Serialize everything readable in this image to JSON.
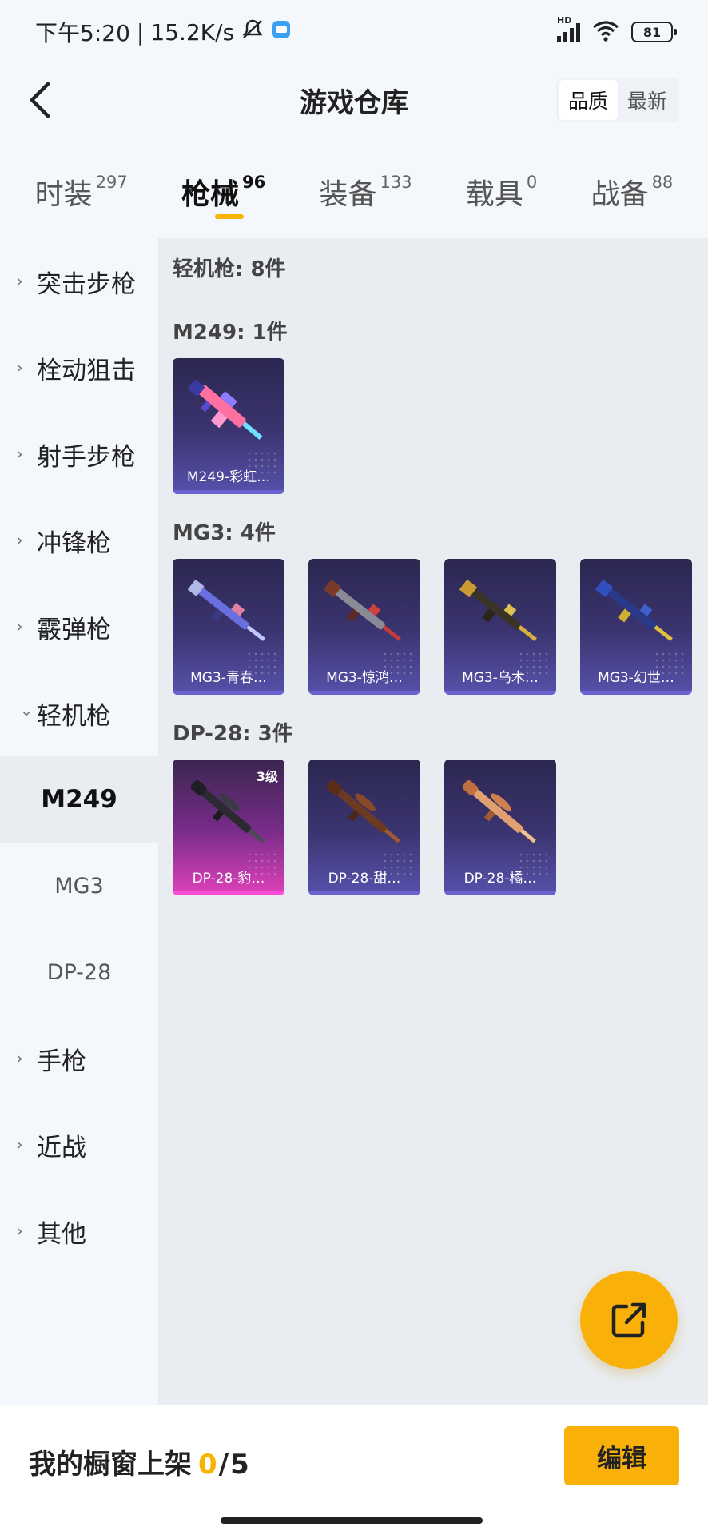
{
  "status_bar": {
    "time": "下午5:20",
    "separator": "|",
    "net_speed": "15.2K/s",
    "network_badge": "HD",
    "battery": "81"
  },
  "header": {
    "title": "游戏仓库",
    "sort_quality": "品质",
    "sort_newest": "最新"
  },
  "tabs": [
    {
      "label": "时装",
      "count": "297"
    },
    {
      "label": "枪械",
      "count": "96"
    },
    {
      "label": "装备",
      "count": "133"
    },
    {
      "label": "载具",
      "count": "0"
    },
    {
      "label": "战备",
      "count": "88"
    }
  ],
  "sidebar": {
    "items": [
      {
        "label": "突击步枪"
      },
      {
        "label": "栓动狙击"
      },
      {
        "label": "射手步枪"
      },
      {
        "label": "冲锋枪"
      },
      {
        "label": "霰弹枪"
      },
      {
        "label": "轻机枪"
      },
      {
        "label": "M249"
      },
      {
        "label": "MG3"
      },
      {
        "label": "DP-28"
      },
      {
        "label": "手枪"
      },
      {
        "label": "近战"
      },
      {
        "label": "其他"
      }
    ]
  },
  "content": {
    "total": "轻机枪: 8件",
    "groups": [
      {
        "title": "M249: 1件",
        "items": [
          {
            "name": "M249-彩虹…"
          }
        ]
      },
      {
        "title": "MG3: 4件",
        "items": [
          {
            "name": "MG3-青春…"
          },
          {
            "name": "MG3-惊鸿…"
          },
          {
            "name": "MG3-乌木…"
          },
          {
            "name": "MG3-幻世…"
          }
        ]
      },
      {
        "title": "DP-28: 3件",
        "items": [
          {
            "name": "DP-28-豹…",
            "level": "3级"
          },
          {
            "name": "DP-28-甜…"
          },
          {
            "name": "DP-28-橘…"
          }
        ]
      }
    ]
  },
  "footer": {
    "showcase_label": "我的橱窗上架",
    "showcase_current": "0",
    "showcase_sep": "/",
    "showcase_max": "5",
    "edit_label": "编辑"
  },
  "colors": {
    "accent": "#f9b10a",
    "card_purple": "#3b3470",
    "card_pink": "#d940b8"
  }
}
